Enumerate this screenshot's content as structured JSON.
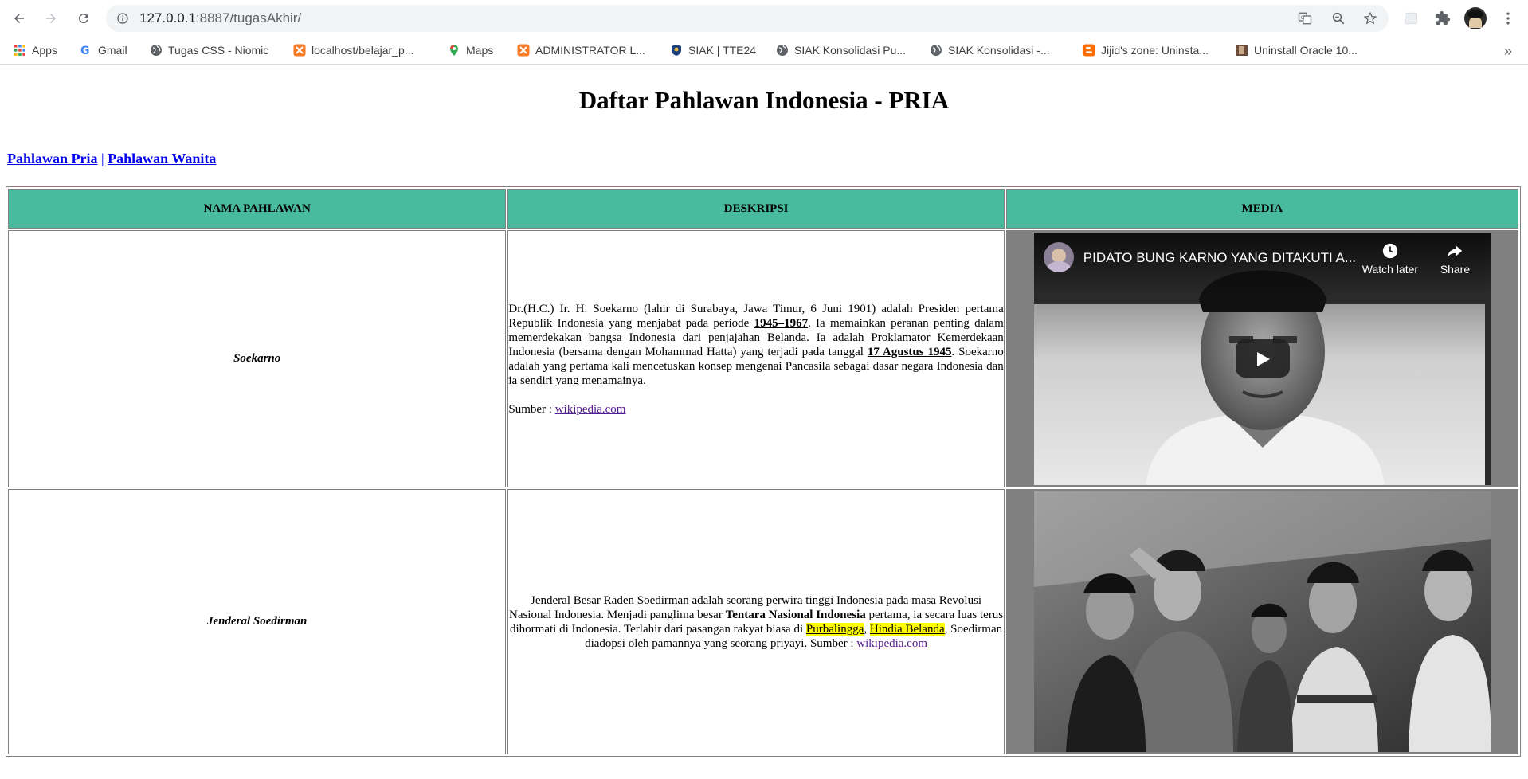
{
  "browser": {
    "url_host": "127.0.0.1",
    "url_rest": ":8887/tugasAkhir/",
    "bookmarks": [
      {
        "label": "Apps",
        "icon": "apps-grid-icon"
      },
      {
        "label": "Gmail",
        "icon": "google-icon"
      },
      {
        "label": "Tugas CSS - Niomic",
        "icon": "globe-icon"
      },
      {
        "label": "localhost/belajar_p...",
        "icon": "xampp-icon"
      },
      {
        "label": "Maps",
        "icon": "maps-pin-icon"
      },
      {
        "label": "ADMINISTRATOR L...",
        "icon": "xampp-icon"
      },
      {
        "label": "SIAK | TTE24",
        "icon": "shield-emblem-icon"
      },
      {
        "label": "SIAK Konsolidasi Pu...",
        "icon": "globe-icon"
      },
      {
        "label": "SIAK Konsolidasi -...",
        "icon": "globe-icon"
      },
      {
        "label": "Jijid's zone: Uninsta...",
        "icon": "blogger-icon"
      },
      {
        "label": "Uninstall Oracle 10...",
        "icon": "thumbnail-icon"
      }
    ]
  },
  "page": {
    "title": "Daftar Pahlawan Indonesia - PRIA",
    "nav": {
      "link_pria": "Pahlawan Pria",
      "separator": "|",
      "link_wanita": "Pahlawan Wanita"
    },
    "table": {
      "headers": [
        "NAMA PAHLAWAN",
        "DESKRIPSI",
        "MEDIA"
      ],
      "header_color": "#48ba9e",
      "rows": [
        {
          "name": "Soekarno",
          "desc": {
            "t1": "Dr.(H.C.) Ir. H. Soekarno (lahir di Surabaya, Jawa Timur, 6 Juni 1901) adalah Presiden pertama Republik Indonesia yang menjabat pada periode ",
            "u1": "1945–1967",
            "t2": ". Ia memainkan peranan penting dalam memerdekakan bangsa Indonesia dari penjajahan Belanda. Ia adalah Proklamator Kemerdekaan Indonesia (bersama dengan Mohammad Hatta) yang terjadi pada tanggal ",
            "u2": "17 Agustus 1945",
            "t3": ". Soekarno adalah yang pertama kali mencetuskan konsep mengenai Pancasila sebagai dasar negara Indonesia dan ia sendiri yang menamainya.",
            "source_label": "Sumber : ",
            "source_link": "wikipedia.com"
          },
          "media": {
            "type": "video",
            "video_title": "PIDATO BUNG KARNO YANG DITAKUTI A...",
            "watch_later": "Watch later",
            "share": "Share"
          }
        },
        {
          "name": "Jenderal Soedirman",
          "desc": {
            "t1": "Jenderal Besar Raden Soedirman adalah seorang perwira tinggi Indonesia pada masa Revolusi Nasional Indonesia. Menjadi panglima besar ",
            "b1": "Tentara Nasional Indonesia",
            "t2": " pertama, ia secara luas terus dihormati di Indonesia. Terlahir dari pasangan rakyat biasa di ",
            "h1": "Purbalingga",
            "comma": ", ",
            "h2": "Hindia Belanda",
            "t3": ", Soedirman diadopsi oleh pamannya yang seorang priyayi. Sumber : ",
            "source_link": "wikipedia.com"
          },
          "media": {
            "type": "photo"
          }
        }
      ]
    }
  }
}
